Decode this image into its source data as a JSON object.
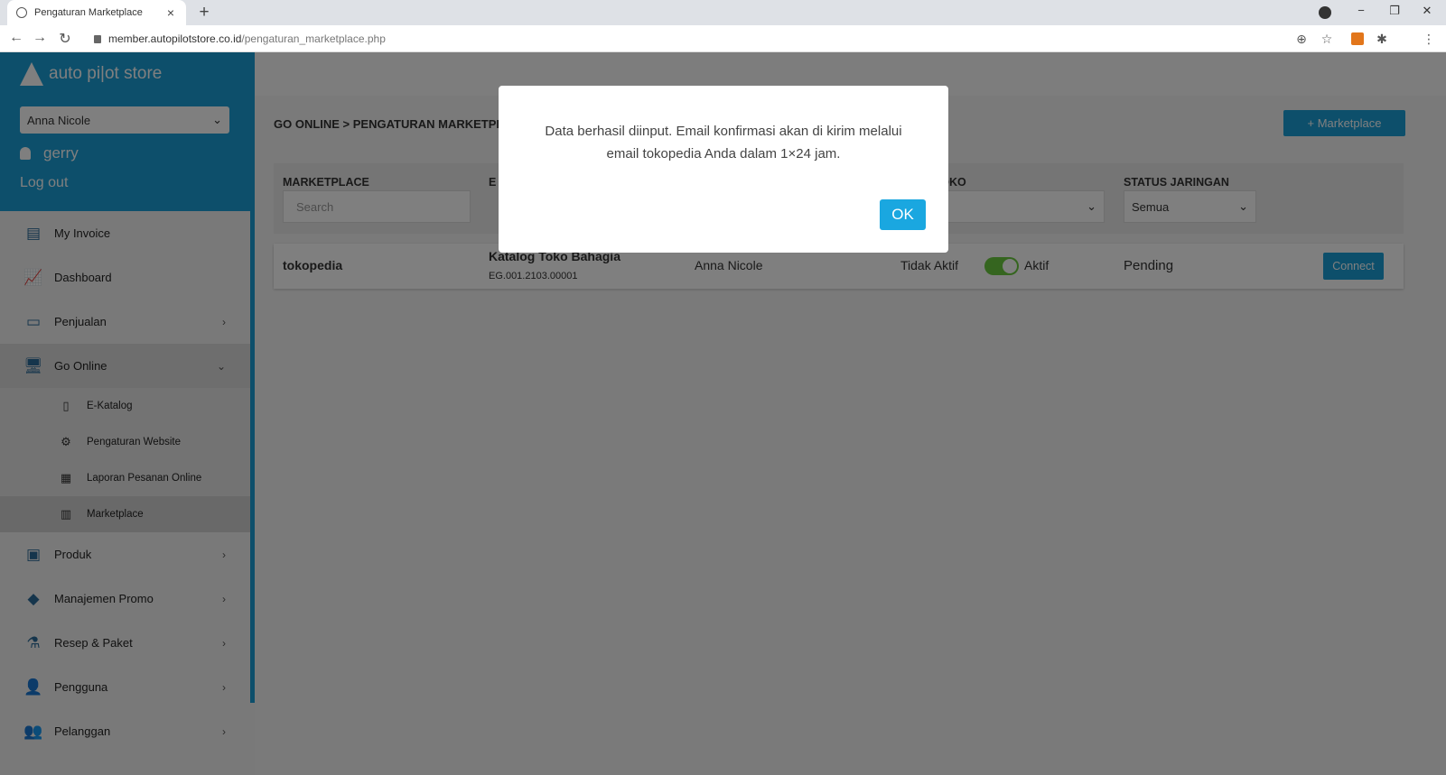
{
  "browser": {
    "tab_title": "Pengaturan Marketplace",
    "tab_close": "×",
    "new_tab": "+",
    "url_host": "member.autopilotstore.co.id",
    "url_path": "/pengaturan_marketplace.php",
    "win_minimize": "−",
    "win_restore": "❐",
    "win_close": "✕",
    "back": "←",
    "forward": "→",
    "reload": "↻",
    "zoom": "⊕",
    "star": "☆",
    "puzzle": "✱",
    "menu": "⋮"
  },
  "sidebar": {
    "logo_text": "auto pi|ot store",
    "store_select": "Anna Nicole",
    "username": "gerry",
    "logout": "Log out",
    "items": [
      {
        "label": "My Invoice",
        "icon": "▤"
      },
      {
        "label": "Dashboard",
        "icon": "📈"
      },
      {
        "label": "Penjualan",
        "icon": "▭",
        "chevron": "›"
      },
      {
        "label": "Go Online",
        "icon": "🖥",
        "chevron": "⌄"
      },
      {
        "label": "Produk",
        "icon": "▣",
        "chevron": "›"
      },
      {
        "label": "Manajemen Promo",
        "icon": "◆",
        "chevron": "›"
      },
      {
        "label": "Resep & Paket",
        "icon": "⚗",
        "chevron": "›"
      },
      {
        "label": "Pengguna",
        "icon": "👤",
        "chevron": "›"
      },
      {
        "label": "Pelanggan",
        "icon": "👥",
        "chevron": "›"
      }
    ],
    "sub_items": [
      {
        "label": "E-Katalog",
        "icon": "▯"
      },
      {
        "label": "Pengaturan Website",
        "icon": "⚙"
      },
      {
        "label": "Laporan Pesanan Online",
        "icon": "▦"
      },
      {
        "label": "Marketplace",
        "icon": "▥"
      }
    ]
  },
  "main": {
    "breadcrumb": "GO ONLINE > PENGATURAN MARKETPL",
    "add_button": "+ Marketplace",
    "filters": {
      "marketplace_label": "MARKETPLACE",
      "marketplace_placeholder": "Search",
      "status_toko_label": "US TOKO",
      "status_toko_value": "ua",
      "status_jaringan_label": "STATUS JARINGAN",
      "status_jaringan_value": "Semua",
      "partial_label": "E"
    },
    "row": {
      "marketplace": "tokopedia",
      "catalog_name": "Katalog Toko Bahagia",
      "catalog_code": "EG.001.2103.00001",
      "store": "Anna Nicole",
      "toggle_off": "Tidak Aktif",
      "toggle_on": "Aktif",
      "network_status": "Pending",
      "connect": "Connect"
    }
  },
  "modal": {
    "message_line1": "Data berhasil diinput. Email konfirmasi akan di kirim melalui",
    "message_line2": "email tokopedia Anda dalam 1×24 jam.",
    "ok": "OK"
  }
}
